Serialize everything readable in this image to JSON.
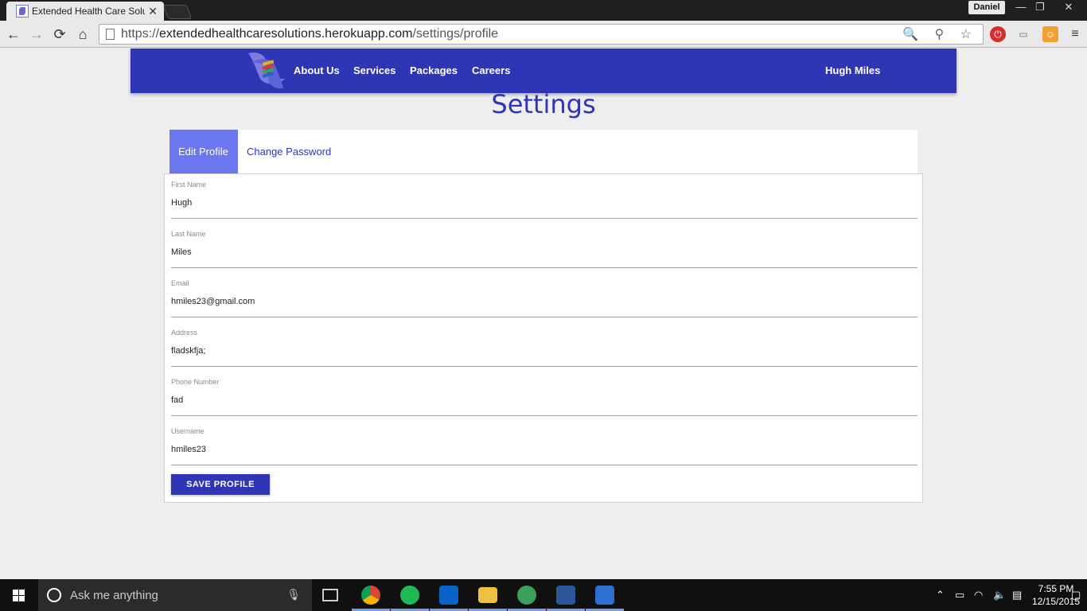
{
  "browser": {
    "tab_title": "Extended Health Care Solu",
    "tab_close": "✕",
    "profile_name": "Daniel",
    "url_scheme": "https://",
    "url_host": "extendedhealthcaresolutions.herokuapp.com",
    "url_path": "/settings/profile",
    "window_controls": {
      "minimize": "—",
      "restore": "❐",
      "close": "✕"
    },
    "nav": {
      "back": "←",
      "forward": "→",
      "reload": "⟳",
      "home": "⌂"
    },
    "omni_icons": "🔍 ⚲ ☆"
  },
  "site": {
    "nav_links": [
      "About Us",
      "Services",
      "Packages",
      "Careers"
    ],
    "user_name": "Hugh Miles",
    "brand_color": "#2e36b5",
    "accent_color": "#6d78f0"
  },
  "page": {
    "title": "Settings",
    "tabs": [
      {
        "label": "Edit Profile",
        "active": true
      },
      {
        "label": "Change Password",
        "active": false
      }
    ],
    "fields": [
      {
        "label": "First Name",
        "value": "Hugh"
      },
      {
        "label": "Last Name",
        "value": "Miles"
      },
      {
        "label": "Email",
        "value": "hmiles23@gmail.com"
      },
      {
        "label": "Address",
        "value": "fladskfja;"
      },
      {
        "label": "Phone Number",
        "value": "fad"
      },
      {
        "label": "Username",
        "value": "hmiles23"
      }
    ],
    "save_label": "SAVE PROFILE"
  },
  "taskbar": {
    "search_placeholder": "Ask me anything",
    "time": "7:55 PM",
    "date": "12/15/2015",
    "apps": [
      "chrome-icon",
      "spotify-icon",
      "outlook-icon",
      "file-explorer-icon",
      "atom-icon",
      "word-icon",
      "powershell-icon"
    ]
  }
}
